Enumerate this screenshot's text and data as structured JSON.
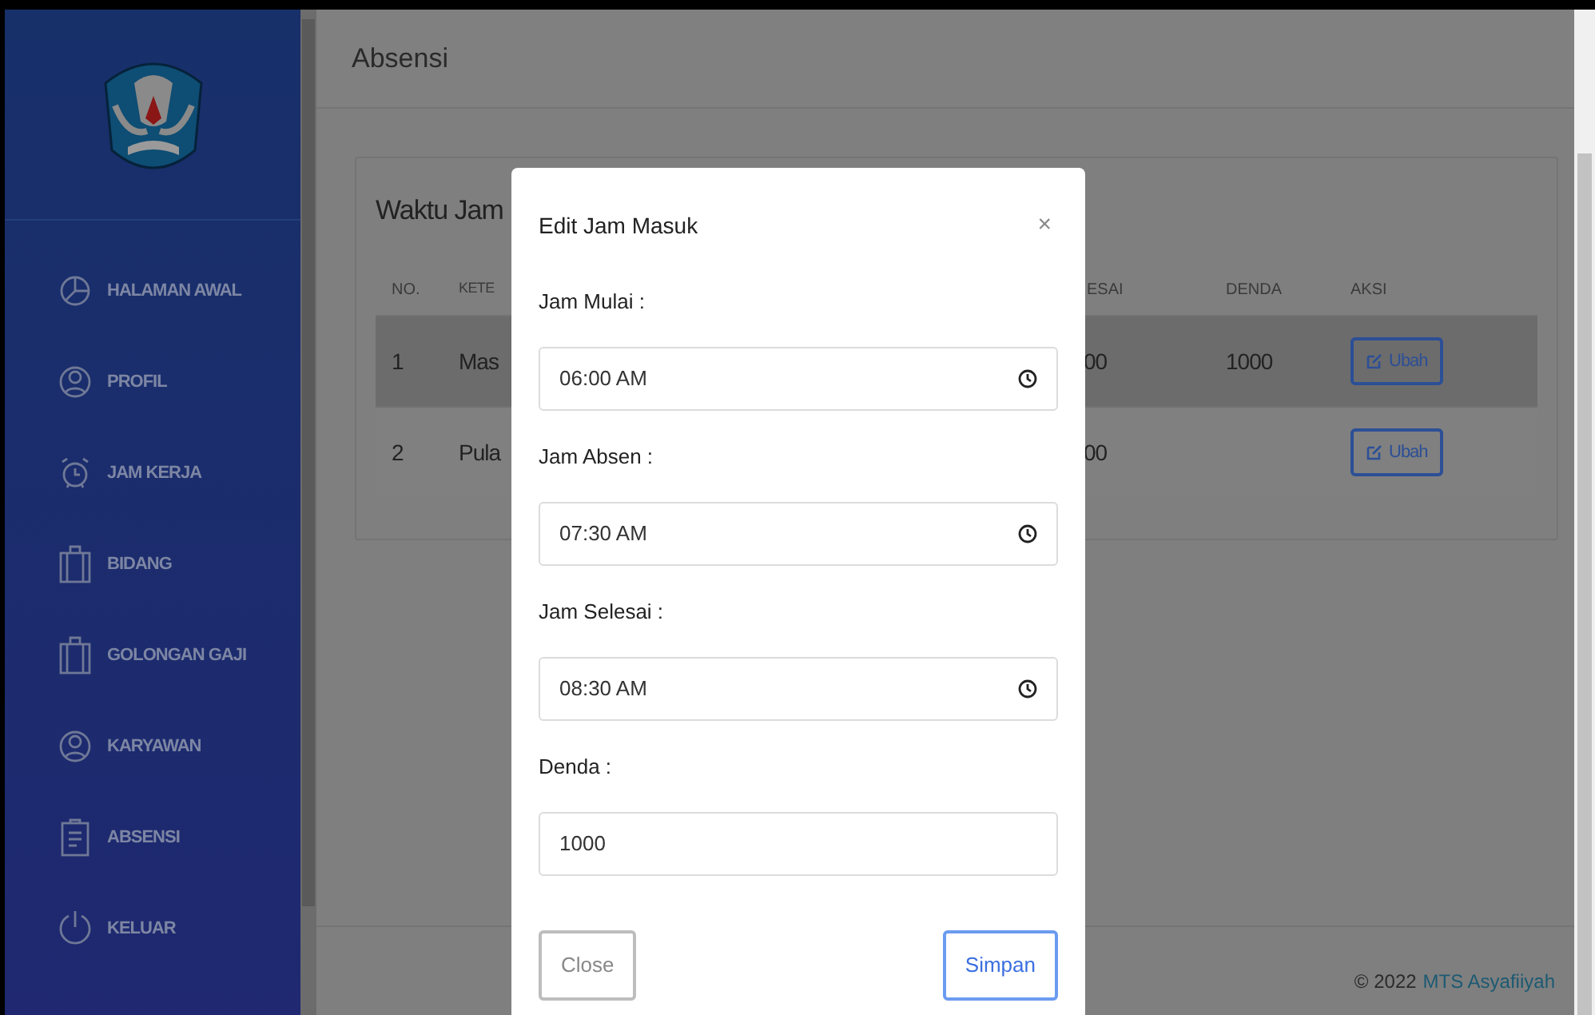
{
  "sidebar": {
    "items": [
      {
        "label": "HALAMAN AWAL",
        "kind": "chart",
        "selected": false
      },
      {
        "label": "PROFIL",
        "kind": "user",
        "selected": false
      },
      {
        "label": "JAM KERJA",
        "kind": "alarm",
        "selected": false
      },
      {
        "label": "BIDANG",
        "kind": "case",
        "selected": false
      },
      {
        "label": "GOLONGAN GAJI",
        "kind": "case",
        "selected": false
      },
      {
        "label": "KARYAWAN",
        "kind": "user",
        "selected": false
      },
      {
        "label": "ABSENSI",
        "kind": "clipboard",
        "selected": false
      },
      {
        "label": "KELUAR",
        "kind": "power",
        "selected": false
      }
    ]
  },
  "header": {
    "title": "Absensi"
  },
  "card": {
    "title": "Waktu Jam",
    "columns": {
      "left": [
        "NO.",
        "KETE"
      ],
      "right": [
        "ESAI",
        "DENDA",
        "AKSI"
      ]
    },
    "rows": [
      {
        "no": "1",
        "column_2": "Mas",
        "column_4": "00",
        "denda": "1000",
        "action": "Ubah",
        "highlighted": true
      },
      {
        "no": "2",
        "column_2": "Pula",
        "column_4": "00",
        "action": "Ubah",
        "highlighted": false
      }
    ]
  },
  "footer": {
    "copyright": "© 2022",
    "link": "MTS Asyafiiyah"
  },
  "modal": {
    "title": "Edit Jam Masuk",
    "close_icon": "×",
    "fields": [
      {
        "label": "Jam Mulai :",
        "value": "06:00 AM",
        "kind": "time"
      },
      {
        "label": "Jam Absen :",
        "value": "07:30 AM",
        "kind": "time"
      },
      {
        "label": "Jam Selesai :",
        "value": "08:30 AM",
        "kind": "time"
      },
      {
        "label": "Denda :",
        "value": "1000",
        "kind": "text"
      }
    ],
    "buttons": [
      {
        "label": "Close",
        "kind": "secondary"
      },
      {
        "label": "Simpan",
        "kind": "primary"
      }
    ]
  }
}
